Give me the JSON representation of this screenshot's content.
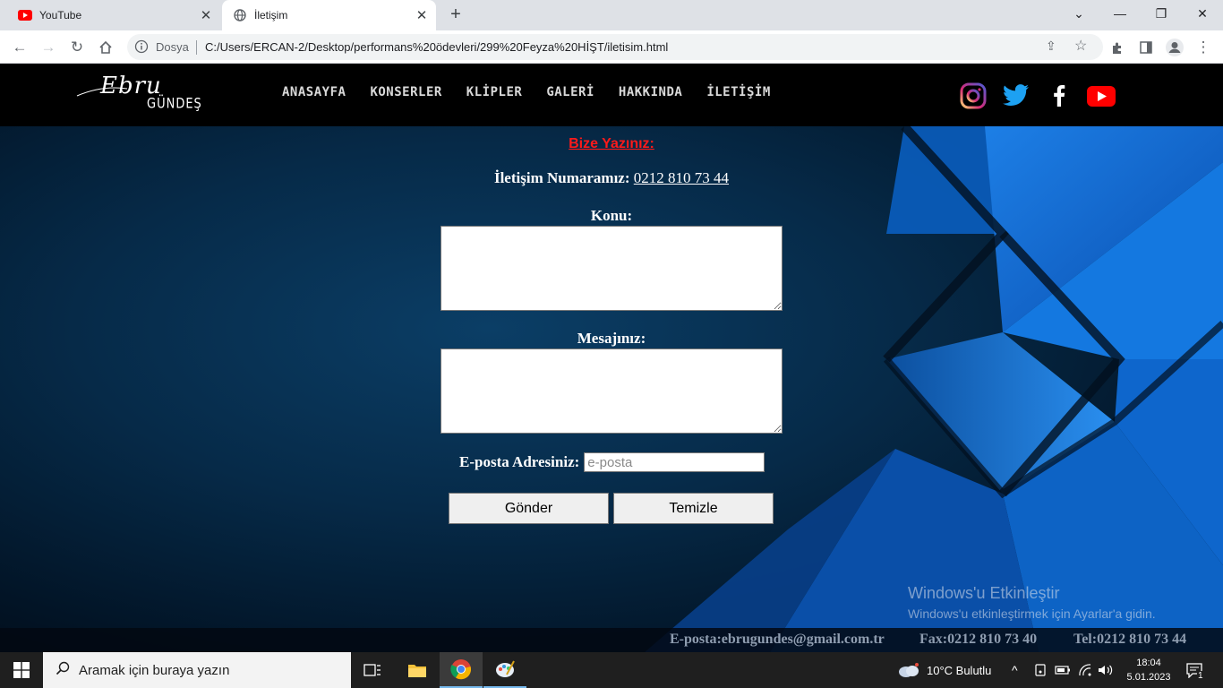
{
  "browser": {
    "tabs": [
      {
        "title": "YouTube",
        "active": false
      },
      {
        "title": "İletişim",
        "active": true
      }
    ],
    "address": {
      "security_label": "Dosya",
      "url": "C:/Users/ERCAN-2/Desktop/performans%20ödevleri/299%20Feyza%20HİŞT/iletisim.html"
    }
  },
  "site": {
    "logo": {
      "script": "Ebru",
      "sub": "GÜNDEŞ"
    },
    "nav": [
      "ANASAYFA",
      "KONSERLER",
      "KLİPLER",
      "GALERİ",
      "HAKKINDA",
      "İLETİŞİM"
    ],
    "social": [
      "instagram-icon",
      "twitter-icon",
      "facebook-icon",
      "youtube-icon"
    ]
  },
  "contact": {
    "title": "Bize Yazınız:",
    "phone_label": "İletişim Numaramız:",
    "phone_number": "0212 810 73 44",
    "subject_label": "Konu:",
    "message_label": "Mesajınız:",
    "email_label": "E-posta Adresiniz:",
    "email_placeholder": "e-posta",
    "submit_label": "Gönder",
    "reset_label": "Temizle"
  },
  "footer": {
    "email": "E-posta:ebrugundes@gmail.com.tr",
    "fax": "Fax:0212 810 73 40",
    "tel": "Tel:0212 810 73 44"
  },
  "watermark": {
    "title": "Windows'u Etkinleştir",
    "subtitle": "Windows'u etkinleştirmek için Ayarlar'a gidin."
  },
  "taskbar": {
    "search_placeholder": "Aramak için buraya yazın",
    "weather": "10°C  Bulutlu",
    "time": "18:04",
    "date": "5.01.2023",
    "notification_count": "1"
  },
  "colors": {
    "accent_title": "#ff1a1a",
    "nav_bg": "#000000",
    "chrome_tabbar": "#dee1e6"
  }
}
